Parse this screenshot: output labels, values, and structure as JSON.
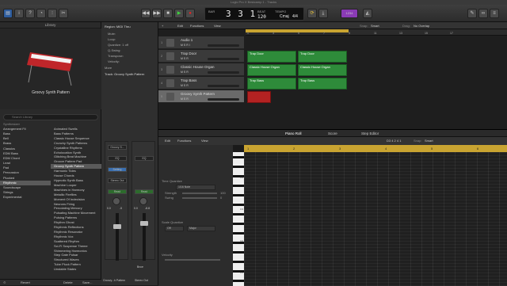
{
  "window_title": "Logic Pro X Bestcamp 1 - Tracks",
  "transport": {
    "position": "3 3 1",
    "beat_label": "1",
    "tempo": "120",
    "key": "Cmaj",
    "signature": "4/4",
    "lcd_small_1": "BAR",
    "lcd_small_2": "BEAT",
    "lcd_small_3": "TEMPO",
    "display_mode_label": "1234"
  },
  "library": {
    "title": "Library",
    "patch_name": "Groovy Synth Pattern",
    "search_placeholder": "Search Library",
    "col1_header": "Synthesizer",
    "col1": [
      "Arrangement Fil",
      "Bass",
      "Bell",
      "Brass",
      "Classics",
      "EDM Bass",
      "EDM Chord",
      "Lead",
      "Pad",
      "Percussion",
      "Plucked",
      "Rhythmic",
      "Soundscape",
      "Strings",
      "Experimental"
    ],
    "col1_selected": 11,
    "col2": [
      "Animated Swells",
      "Bass Patterns",
      "Classic House Sequence",
      "Crunchy Synth Patterns",
      "Crystalline Rhythms",
      "Echolocation Synth",
      "Glitching Beat Machine",
      "Groove Pattern Pad",
      "Groovy Synth Pattern",
      "Harmonic Tides",
      "House Chords",
      "Hypnotic Synth Bass",
      "Machine Looper",
      "Machines in Harmony",
      "Metallic Fireflies",
      "Moment Of Indecision",
      "Neurons Firing",
      "Percolating Mercury",
      "Pulsating Machine Movement",
      "Pulsing Patterns",
      "Rhythm Ghost",
      "Rhythmic Reflections",
      "Rhythmic Resonator",
      "Rhythmic Vox",
      "Scattered Rhythm",
      "Sci-Fi Suspense Theme",
      "Shimmering Harmonics",
      "Step Gate Pulsar",
      "Structured Waves",
      "Tube Pluck Pattern",
      "Unstable States"
    ],
    "col2_selected": 8,
    "footer": {
      "revert": "Revert",
      "delete": "Delete",
      "save": "Save..."
    }
  },
  "inspector": {
    "region_header": "Region: MIDI Thru",
    "rows": [
      "Mute:",
      "Loop:",
      "Quantize: 1  off",
      "Q-Swing:",
      "Transpose:",
      "Velocity:"
    ],
    "more": "More",
    "track_header": "Track: Groovy Synth Pattern",
    "strip1": {
      "plugin": "Groovy S...",
      "eq": "EQ",
      "input": "Setting",
      "sends": "Stereo Out",
      "read": "Read",
      "value_left": "0.0",
      "value_right": "-5",
      "name": "Groovy...h Pattern"
    },
    "strip2": {
      "plugin": "",
      "eq": "EQ",
      "input": "",
      "sends": "",
      "read": "Read",
      "value_left": "0.0",
      "value_right": "-8.8",
      "bnce": "Bnce",
      "name": "Stereo Out"
    }
  },
  "tracks_toolbar": {
    "edit": "Edit",
    "functions": "Functions",
    "view": "View",
    "snap_label": "Snap:",
    "snap_value": "Smart",
    "drag_label": "Drag:",
    "drag_value": "No Overlap"
  },
  "ruler": [
    "1",
    "3",
    "5",
    "7",
    "9",
    "11",
    "13",
    "15",
    "17"
  ],
  "tracks": [
    {
      "num": "1",
      "name": "Audio 1",
      "controls": "M S R I"
    },
    {
      "num": "2",
      "name": "Trap Door",
      "controls": "M S R"
    },
    {
      "num": "3",
      "name": "Classic House Organ",
      "controls": "M S R"
    },
    {
      "num": "4",
      "name": "Trap Bass",
      "controls": "M S R"
    },
    {
      "num": "5",
      "name": "Groovy Synth Pattern",
      "controls": "M S R"
    }
  ],
  "regions": [
    {
      "label": "Trap Door"
    },
    {
      "label": "Trap Door"
    },
    {
      "label": "Classic House Organ"
    },
    {
      "label": "Classic House Organ"
    },
    {
      "label": "Trap Bass"
    },
    {
      "label": "Trap Bass"
    }
  ],
  "editor": {
    "tabs": [
      "Piano Roll",
      "Score",
      "Step Editor"
    ],
    "edit": "Edit",
    "functions": "Functions",
    "view": "View",
    "position": "D3 4 2 4 1",
    "snap_label": "Snap:",
    "snap_value": "Smart",
    "time_quantize": "Time Quantize",
    "time_quantize_value": "1/16 Note",
    "strength": "Strength",
    "strength_value": "100",
    "swing": "Swing",
    "swing_value": "0",
    "scale_quantize": "Scale Quantize",
    "scale_off": "Off",
    "scale_major": "Major",
    "velocity": "Velocity",
    "ruler": [
      "1",
      "2",
      "3",
      "4",
      "5",
      "6"
    ],
    "key_labels": [
      "C4",
      "C3",
      "C2",
      "C1"
    ]
  },
  "colors": {
    "region_green": "#2e8b3a",
    "region_red": "#b32222",
    "cycle_yellow": "#c9a431",
    "accent_purple": "#8a3bb5"
  }
}
